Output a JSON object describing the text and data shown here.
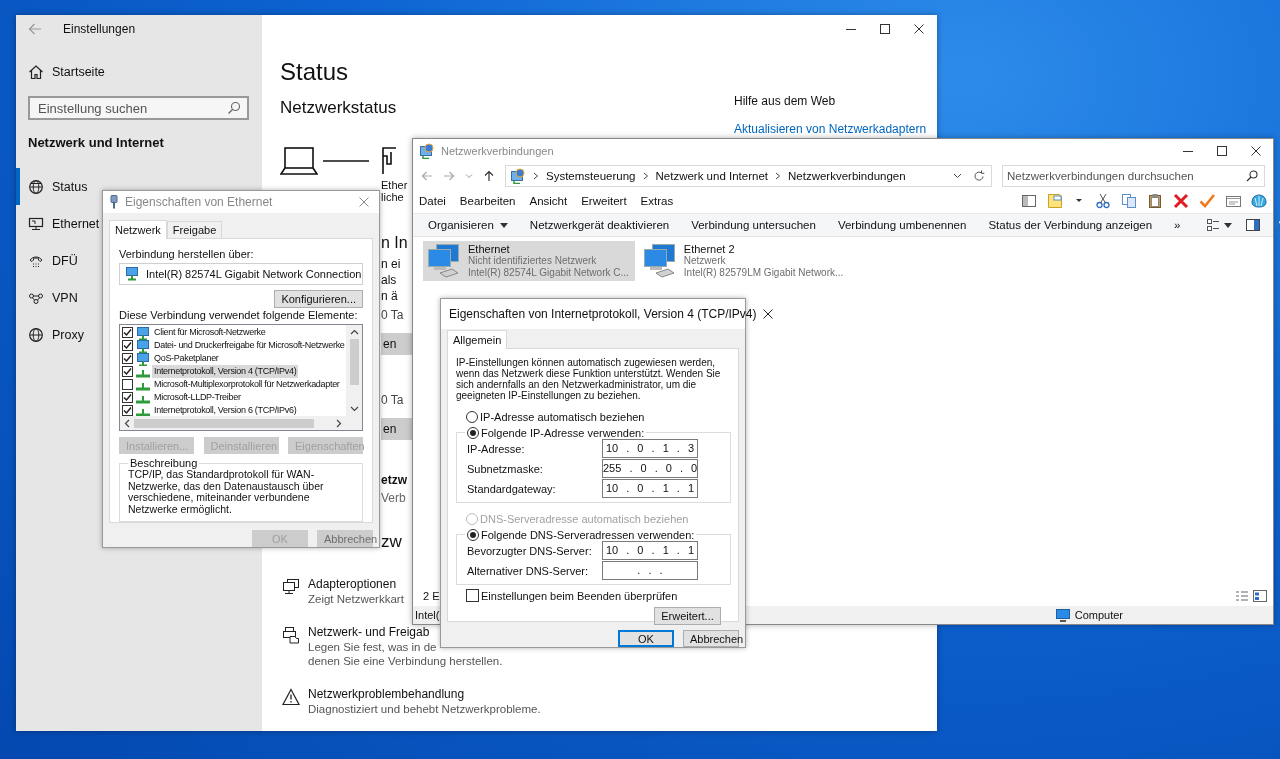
{
  "settings_window": {
    "title": "Einstellungen",
    "home": "Startseite",
    "search": {
      "placeholder": "Einstellung suchen"
    },
    "section": "Netzwerk und Internet",
    "nav_items": [
      {
        "label": "Status",
        "selected": true
      },
      {
        "label": "Ethernet",
        "selected": false
      },
      {
        "label": "DFÜ",
        "selected": false
      },
      {
        "label": "VPN",
        "selected": false
      },
      {
        "label": "Proxy",
        "selected": false
      }
    ],
    "page_title": "Status",
    "heading": "Netzwerkstatus",
    "peek_texts": [
      {
        "kind": "caption",
        "text": "Ether"
      },
      {
        "kind": "caption",
        "text": "liche"
      },
      {
        "kind": "heading",
        "text": "n In"
      },
      {
        "kind": "text",
        "text": "n ei"
      },
      {
        "kind": "text",
        "text": "als"
      },
      {
        "kind": "text",
        "text": "n ä"
      },
      {
        "kind": "meta",
        "text": "0 Ta"
      },
      {
        "kind": "button",
        "text": "en"
      },
      {
        "kind": "meta2",
        "text": "0 Ta"
      },
      {
        "kind": "button",
        "text": "en"
      },
      {
        "kind": "subheading",
        "text": "etzw"
      },
      {
        "kind": "muted",
        "text": "Verb"
      },
      {
        "kind": "heading2",
        "text": "zw"
      }
    ],
    "options": [
      {
        "title": "Adapteroptionen",
        "lines": [
          "Zeigt Netzwerkkart"
        ]
      },
      {
        "title": "Netzwerk- und Freigab",
        "lines": [
          "Legen Sie fest, was in de",
          "denen Sie eine Verbindung herstellen."
        ]
      },
      {
        "title": "Netzwerkproblembehandlung",
        "lines": [
          "Diagnostiziert und behebt Netzwerkprobleme."
        ]
      }
    ],
    "help": {
      "title": "Hilfe aus dem Web",
      "link": "Aktualisieren von Netzwerkadaptern"
    }
  },
  "ethernet_dialog": {
    "title": "Eigenschaften von Ethernet",
    "tabs": [
      {
        "label": "Netzwerk",
        "selected": true
      },
      {
        "label": "Freigabe",
        "selected": false
      }
    ],
    "connect_label": "Verbindung herstellen über:",
    "adapter": "Intel(R) 82574L Gigabit Network Connection",
    "configure_button": "Konfigurieren...",
    "items_label": "Diese Verbindung verwendet folgende Elemente:",
    "items": [
      {
        "kind": "service",
        "label": "Client für Microsoft-Netzwerke",
        "checked": true,
        "selected": false
      },
      {
        "kind": "service",
        "label": "Datei- und Druckerfreigabe für Microsoft-Netzwerke",
        "checked": true,
        "selected": false
      },
      {
        "kind": "service",
        "label": "QoS-Paketplaner",
        "checked": true,
        "selected": false
      },
      {
        "kind": "protocol",
        "label": "Internetprotokoll, Version 4 (TCP/IPv4)",
        "checked": true,
        "selected": true
      },
      {
        "kind": "protocol",
        "label": "Microsoft-Multiplexorprotokoll für Netzwerkadapter",
        "checked": false,
        "selected": false
      },
      {
        "kind": "protocol",
        "label": "Microsoft-LLDP-Treiber",
        "checked": true,
        "selected": false
      },
      {
        "kind": "protocol",
        "label": "Internetprotokoll, Version 6 (TCP/IPv6)",
        "checked": true,
        "selected": false
      }
    ],
    "item_buttons": [
      {
        "label": "Installieren...",
        "disabled": true
      },
      {
        "label": "Deinstallieren",
        "disabled": true
      },
      {
        "label": "Eigenschaften",
        "disabled": true
      }
    ],
    "description": {
      "title": "Beschreibung",
      "text": "TCP/IP, das Standardprotokoll für WAN-Netzwerke, das den Datenaustausch über verschiedene, miteinander verbundene Netzwerke ermöglicht."
    },
    "buttons": [
      {
        "label": "OK",
        "disabled": true
      },
      {
        "label": "Abbrechen",
        "disabled": false
      }
    ]
  },
  "connections_window": {
    "title": "Netzwerkverbindungen",
    "breadcrumb": [
      "Systemsteuerung",
      "Netzwerk und Internet",
      "Netzwerkverbindungen"
    ],
    "search": {
      "placeholder": "Netzwerkverbindungen durchsuchen"
    },
    "menu": [
      "Datei",
      "Bearbeiten",
      "Ansicht",
      "Erweitert",
      "Extras"
    ],
    "commands": [
      {
        "label": "Organisieren",
        "dropdown": true
      },
      {
        "label": "Netzwerkgerät deaktivieren",
        "dropdown": false
      },
      {
        "label": "Verbindung untersuchen",
        "dropdown": false
      },
      {
        "label": "Verbindung umbenennen",
        "dropdown": false
      },
      {
        "label": "Status der Verbindung anzeigen",
        "dropdown": false
      },
      {
        "label": "»",
        "dropdown": false
      }
    ],
    "connections": [
      {
        "name": "Ethernet",
        "status": "Nicht identifiziertes Netzwerk",
        "adapter": "Intel(R) 82574L Gigabit Network C...",
        "selected": true
      },
      {
        "name": "Ethernet 2",
        "status": "Netzwerk",
        "adapter": "Intel(R) 82579LM Gigabit Network...",
        "selected": false
      }
    ],
    "item_count": "2 E",
    "status_bar": {
      "text": "Intel(",
      "location": "Computer"
    }
  },
  "ipv4_dialog": {
    "title": "Eigenschaften von Internetprotokoll, Version 4 (TCP/IPv4)",
    "tabs": [
      {
        "label": "Allgemein",
        "selected": true
      }
    ],
    "intro": "IP-Einstellungen können automatisch zugewiesen werden, wenn das Netzwerk diese Funktion unterstützt. Wenden Sie sich andernfalls an den Netzwerkadministrator, um die geeigneten IP-Einstellungen zu beziehen.",
    "ip_options": [
      {
        "label": "IP-Adresse automatisch beziehen",
        "selected": false,
        "disabled": false
      },
      {
        "label": "Folgende IP-Adresse verwenden:",
        "selected": true,
        "disabled": false
      }
    ],
    "ip_fields": [
      {
        "label": "IP-Adresse:",
        "value": "10 . 0 . 1 . 3"
      },
      {
        "label": "Subnetzmaske:",
        "value": "255 . 0 . 0 . 0"
      },
      {
        "label": "Standardgateway:",
        "value": "10 . 0 . 1 . 1"
      }
    ],
    "dns_options": [
      {
        "label": "DNS-Serveradresse automatisch beziehen",
        "selected": false,
        "disabled": true
      },
      {
        "label": "Folgende DNS-Serveradressen verwenden:",
        "selected": true,
        "disabled": false
      }
    ],
    "dns_fields": [
      {
        "label": "Bevorzugter DNS-Server:",
        "value": "10 . 0 . 1 . 1"
      },
      {
        "label": "Alternativer DNS-Server:",
        "value": ". . ."
      }
    ],
    "validate": {
      "label": "Einstellungen beim Beenden überprüfen",
      "checked": false
    },
    "advanced_button": "Erweitert...",
    "buttons": [
      {
        "label": "OK",
        "default": true
      },
      {
        "label": "Abbrechen",
        "default": false
      }
    ]
  }
}
